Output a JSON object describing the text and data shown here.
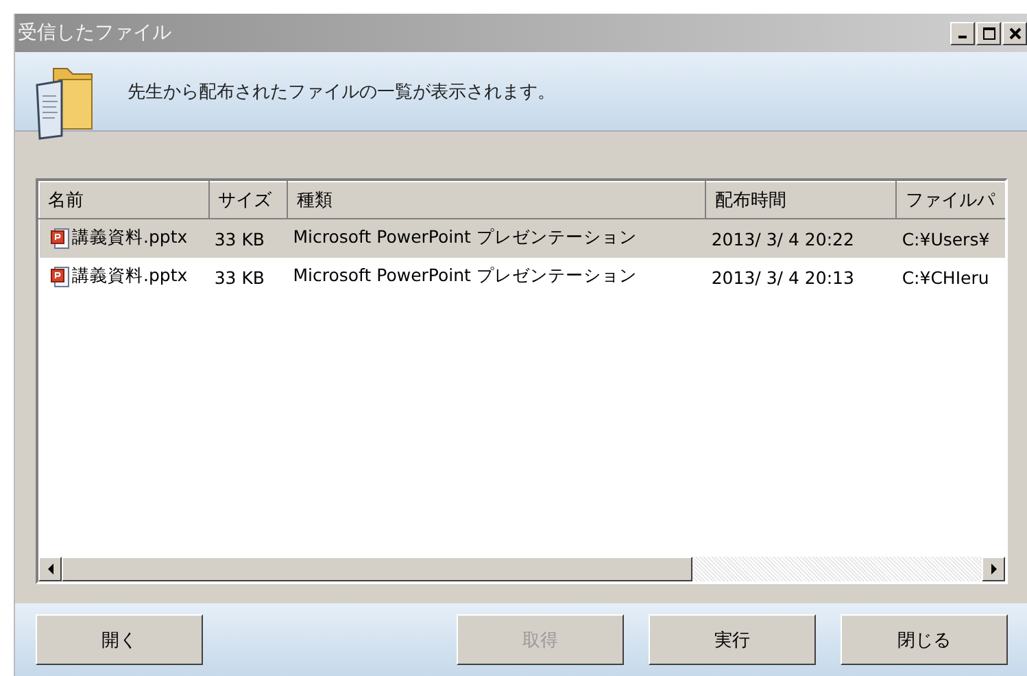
{
  "window": {
    "title": "受信したファイル"
  },
  "header": {
    "message": "先生から配布されたファイルの一覧が表示されます。"
  },
  "table": {
    "columns": [
      "名前",
      "サイズ",
      "種類",
      "配布時間",
      "ファイルパ"
    ],
    "rows": [
      {
        "selected": true,
        "cells": [
          "講義資料.pptx",
          "33 KB",
          "Microsoft PowerPoint プレゼンテーション",
          "2013/ 3/ 4 20:22",
          "C:¥Users¥"
        ]
      },
      {
        "selected": false,
        "cells": [
          "講義資料.pptx",
          "33 KB",
          "Microsoft PowerPoint プレゼンテーション",
          "2013/ 3/ 4 20:13",
          "C:¥CHIeru"
        ]
      }
    ]
  },
  "buttons": [
    {
      "label": "開く",
      "disabled": false
    },
    {
      "label": "取得",
      "disabled": true
    },
    {
      "label": "実行",
      "disabled": false
    },
    {
      "label": "閉じる",
      "disabled": false
    }
  ]
}
